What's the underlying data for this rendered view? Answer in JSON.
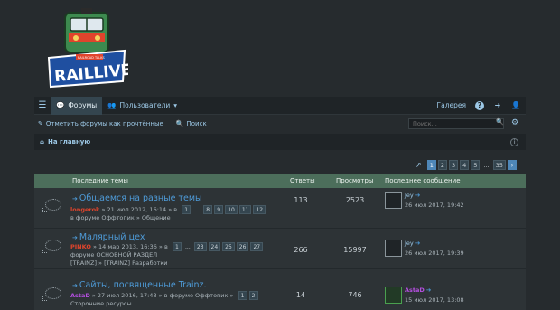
{
  "logo": {
    "text": "RAILLIVE",
    "tag": "RAILROAD TALKS"
  },
  "nav": {
    "forums": "Форумы",
    "users": "Пользователи",
    "gallery": "Галерея"
  },
  "subbar": {
    "mark_read": "Отметить форумы как прочтённые",
    "search": "Поиск",
    "search_placeholder": "Поиск..."
  },
  "crumb": {
    "home": "На главную"
  },
  "pager": [
    "1",
    "2",
    "3",
    "4",
    "5",
    "...",
    "35"
  ],
  "table": {
    "headers": {
      "topics": "Последние темы",
      "replies": "Ответы",
      "views": "Просмотры",
      "last": "Последнее сообщение"
    },
    "rows": [
      {
        "title": "Общаемся на разные темы",
        "author": "longerok",
        "author_color": "#e0442c",
        "meta": "» 21 июл 2012, 16:14 » в",
        "forum_line": "в форуме Оффтопик » Общение",
        "pages": [
          "1",
          "...",
          "8",
          "9",
          "10",
          "11",
          "12"
        ],
        "replies": "113",
        "views": "2523",
        "last_user": "Jey",
        "last_date": "26 июл 2017, 19:42"
      },
      {
        "title": "Малярный цех",
        "author": "PINKO",
        "author_color": "#e0442c",
        "meta": "» 14 мар 2013, 16:36 » в",
        "forum_line": "форуме ОСНОВНОЙ РАЗДЕЛ",
        "forum_line2": "[TRAINZ] » [TRAINZ] Разработки",
        "pages": [
          "1",
          "...",
          "23",
          "24",
          "25",
          "26",
          "27"
        ],
        "replies": "266",
        "views": "15997",
        "last_user": "Jey",
        "last_date": "26 июл 2017, 19:39"
      },
      {
        "title": "Сайты, посвященные Trainz.",
        "author": "AstaD",
        "author_color": "#b44fe0",
        "meta": "» 27 июл 2016, 17:43 » в форуме Оффтопик »",
        "forum_line": "Сторонние ресурсы",
        "pages": [
          "1",
          "2"
        ],
        "replies": "14",
        "views": "746",
        "last_user": "AstaD",
        "last_date": "15 июл 2017, 13:08"
      }
    ]
  }
}
